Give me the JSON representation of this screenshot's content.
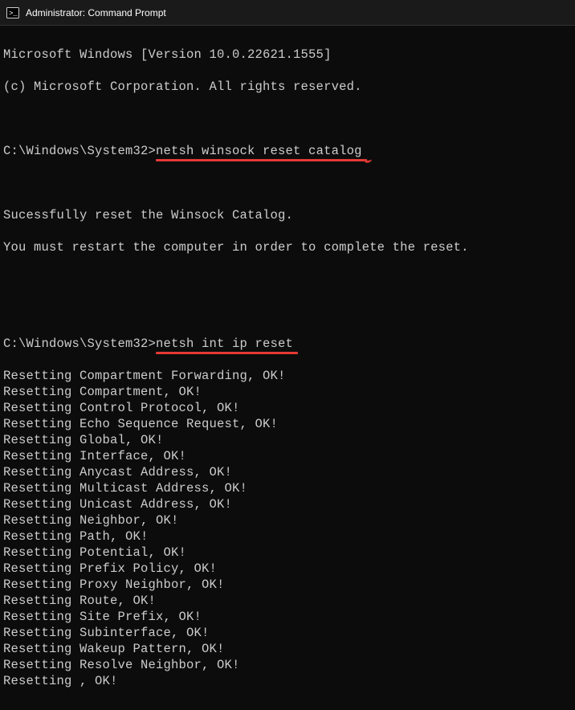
{
  "titlebar": {
    "title": "Administrator: Command Prompt"
  },
  "terminal": {
    "header1": "Microsoft Windows [Version 10.0.22621.1555]",
    "header2": "(c) Microsoft Corporation. All rights reserved.",
    "blank": "",
    "prompt": "C:\\Windows\\System32>",
    "cmd1": "netsh winsock reset catalog",
    "out1a": "Sucessfully reset the Winsock Catalog.",
    "out1b": "You must restart the computer in order to complete the reset.",
    "cmd2": "netsh int ip reset",
    "reset_lines": [
      "Resetting Compartment Forwarding, OK!",
      "Resetting Compartment, OK!",
      "Resetting Control Protocol, OK!",
      "Resetting Echo Sequence Request, OK!",
      "Resetting Global, OK!",
      "Resetting Interface, OK!",
      "Resetting Anycast Address, OK!",
      "Resetting Multicast Address, OK!",
      "Resetting Unicast Address, OK!",
      "Resetting Neighbor, OK!",
      "Resetting Path, OK!",
      "Resetting Potential, OK!",
      "Resetting Prefix Policy, OK!",
      "Resetting Proxy Neighbor, OK!",
      "Resetting Route, OK!",
      "Resetting Site Prefix, OK!",
      "Resetting Subinterface, OK!",
      "Resetting Wakeup Pattern, OK!",
      "Resetting Resolve Neighbor, OK!",
      "Resetting , OK!"
    ]
  }
}
